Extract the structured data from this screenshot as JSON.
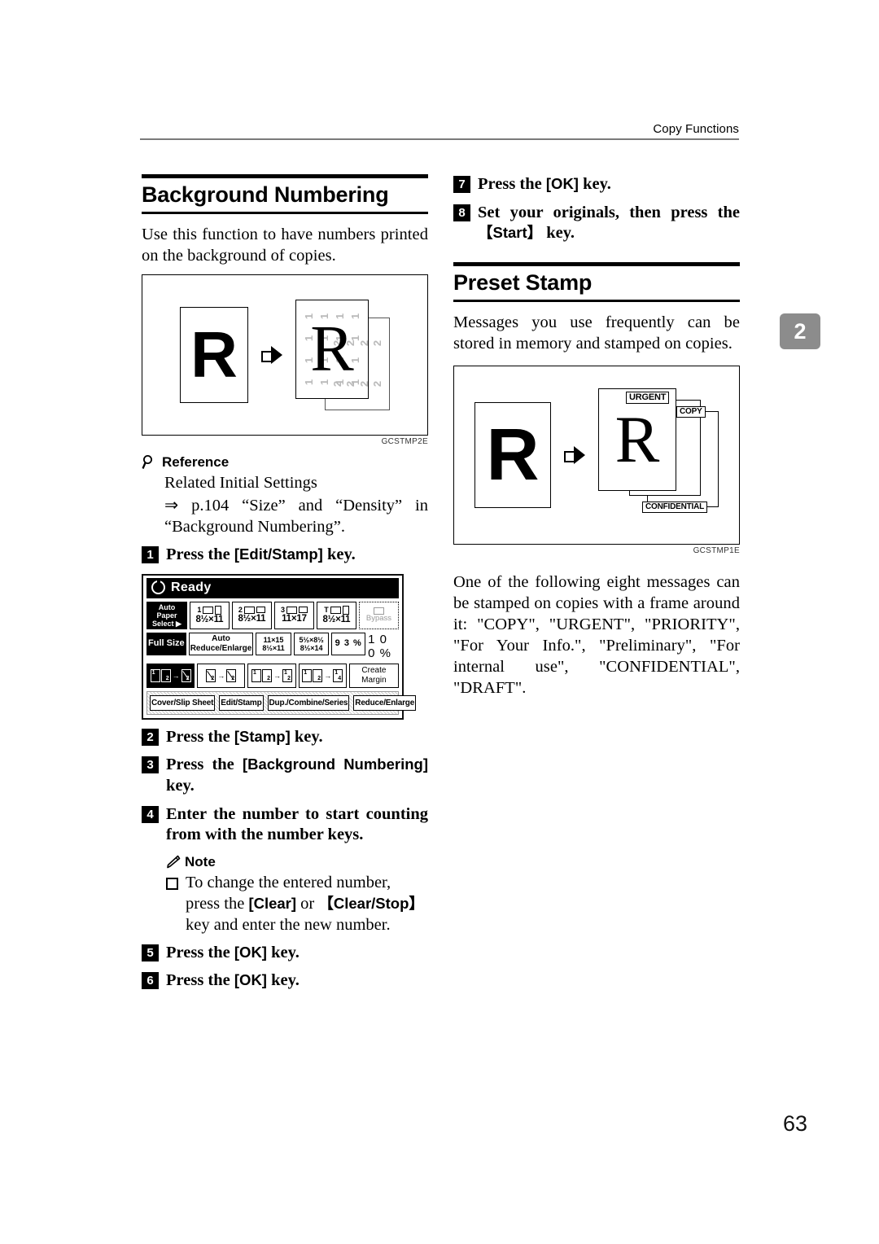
{
  "header": {
    "running_title": "Copy Functions"
  },
  "chapter_tab": {
    "number": "2"
  },
  "page_number": "63",
  "left_column": {
    "section": {
      "title": "Background Numbering",
      "intro": "Use this function to have numbers printed on the background of copies."
    },
    "figure": {
      "caption": "GCSTMP2E",
      "source_letter": "R",
      "output_letter": "R",
      "background_numbers_front": [
        "1",
        "1",
        "1",
        "1",
        "1",
        "1",
        "1",
        "1",
        "1",
        "1",
        "1",
        "1",
        "1",
        "1",
        "1",
        "1"
      ],
      "background_numbers_back": [
        "2",
        "2",
        "2",
        "2",
        "2",
        "2",
        "2",
        "2"
      ]
    },
    "reference": {
      "label": "Reference",
      "icon": "magnifier-icon",
      "line1": "Related Initial Settings",
      "line2": "⇒ p.104 “Size” and “Density” in “Background Numbering”."
    },
    "steps": [
      {
        "num": "1",
        "text_before": "Press the ",
        "key": "[Edit/Stamp]",
        "text_after": " key."
      },
      {
        "num": "2",
        "text_before": "Press the ",
        "key": "[Stamp]",
        "text_after": " key."
      },
      {
        "num": "3",
        "text_before": "Press the ",
        "key": "[Background Numbering]",
        "text_after": " key."
      },
      {
        "num": "4",
        "text_before": "Enter the number to start counting from with the number keys.",
        "key": "",
        "text_after": ""
      },
      {
        "num": "5",
        "text_before": "Press the ",
        "key": "[OK]",
        "text_after": " key."
      },
      {
        "num": "6",
        "text_before": "Press the ",
        "key": "[OK]",
        "text_after": " key."
      }
    ],
    "note": {
      "label": "Note",
      "icon": "pencil-icon",
      "item_part1": "To change the entered number, press the ",
      "item_key1": "[Clear]",
      "item_part2": " or ",
      "item_key2": "【Clear/Stop】",
      "item_part3": " key and enter the new number."
    },
    "lcd": {
      "status": "Ready",
      "status_icon": "power-icon",
      "paper_row": {
        "auto_paper_label_line1": "Auto Paper",
        "auto_paper_label_line2": "Select ▶",
        "trays": [
          {
            "id": "1",
            "size": "8½×11"
          },
          {
            "id": "2",
            "size": "8½×11"
          },
          {
            "id": "3",
            "size": "11×17"
          },
          {
            "id": "T",
            "size": "8½×11"
          }
        ],
        "bypass_label": "Bypass"
      },
      "zoom_row": {
        "full_size": "Full Size",
        "auto_reduce": "Auto Reduce/Enlarge",
        "ratio1_top": "11×15",
        "ratio1_bot": "8½×11",
        "ratio2_top": "5½×8½",
        "ratio2_bot": "8½×14",
        "percent_93": "9 3 %",
        "percent_100": "1 0 0 %"
      },
      "duplex_row": {
        "create_margin_line1": "Create",
        "create_margin_line2": "Margin"
      },
      "tabs": [
        "Cover/Slip Sheet",
        "Edit/Stamp",
        "Dup./Combine/Series",
        "Reduce/Enlarge"
      ]
    }
  },
  "right_column": {
    "top_steps": [
      {
        "num": "7",
        "text_before": "Press the ",
        "key": "[OK]",
        "text_after": " key."
      },
      {
        "num": "8",
        "text_before": "Set your originals, then press the ",
        "key": "【Start】",
        "text_after": " key."
      }
    ],
    "section": {
      "title": "Preset Stamp",
      "intro": "Messages you use frequently can be stored in memory and stamped on copies."
    },
    "figure": {
      "caption": "GCSTMP1E",
      "source_letter": "R",
      "output_letter": "R",
      "stamps": [
        "URGENT",
        "COPY",
        "CONFIDENTIAL"
      ]
    },
    "body": "One of the following eight messages can be stamped on copies with a frame around it: \"COPY\", \"URGENT\", \"PRIORITY\", \"For Your Info.\", \"Preliminary\", \"For internal use\", \"CONFIDENTIAL\", \"DRAFT\"."
  }
}
